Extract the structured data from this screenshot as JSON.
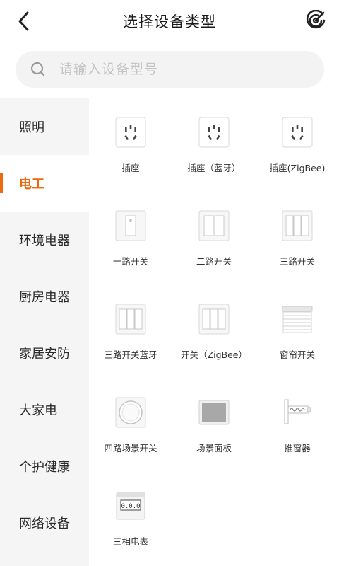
{
  "header": {
    "title": "选择设备类型",
    "back_icon": "chevron-left-icon",
    "scan_icon": "scan-icon"
  },
  "search": {
    "placeholder": "请输入设备型号",
    "value": "",
    "icon": "search-icon"
  },
  "colors": {
    "accent": "#ee6a11",
    "sidebar_bg": "#f5f5f5",
    "search_bg": "#f3f3f3"
  },
  "sidebar": {
    "items": [
      {
        "label": "照明",
        "active": false
      },
      {
        "label": "电工",
        "active": true
      },
      {
        "label": "环境电器",
        "active": false
      },
      {
        "label": "厨房电器",
        "active": false
      },
      {
        "label": "家居安防",
        "active": false
      },
      {
        "label": "大家电",
        "active": false
      },
      {
        "label": "个护健康",
        "active": false
      },
      {
        "label": "网络设备",
        "active": false
      }
    ]
  },
  "devices": [
    {
      "label": "插座",
      "icon": "socket-icon"
    },
    {
      "label": "插座（蓝牙）",
      "icon": "socket-bluetooth-icon"
    },
    {
      "label": "插座(ZigBee)",
      "icon": "socket-zigbee-icon"
    },
    {
      "label": "一路开关",
      "icon": "switch-1-gang-icon"
    },
    {
      "label": "二路开关",
      "icon": "switch-2-gang-icon"
    },
    {
      "label": "三路开关",
      "icon": "switch-3-gang-icon"
    },
    {
      "label": "三路开关蓝牙",
      "icon": "switch-3-gang-bluetooth-icon"
    },
    {
      "label": "开关（ZigBee）",
      "icon": "switch-zigbee-icon"
    },
    {
      "label": "窗帘开关",
      "icon": "curtain-switch-icon"
    },
    {
      "label": "四路场景开关",
      "icon": "scene-switch-4-icon"
    },
    {
      "label": "场景面板",
      "icon": "scene-panel-icon"
    },
    {
      "label": "推窗器",
      "icon": "window-pusher-icon"
    },
    {
      "label": "三相电表",
      "icon": "three-phase-meter-icon"
    }
  ],
  "meter_display": "0.0.0"
}
